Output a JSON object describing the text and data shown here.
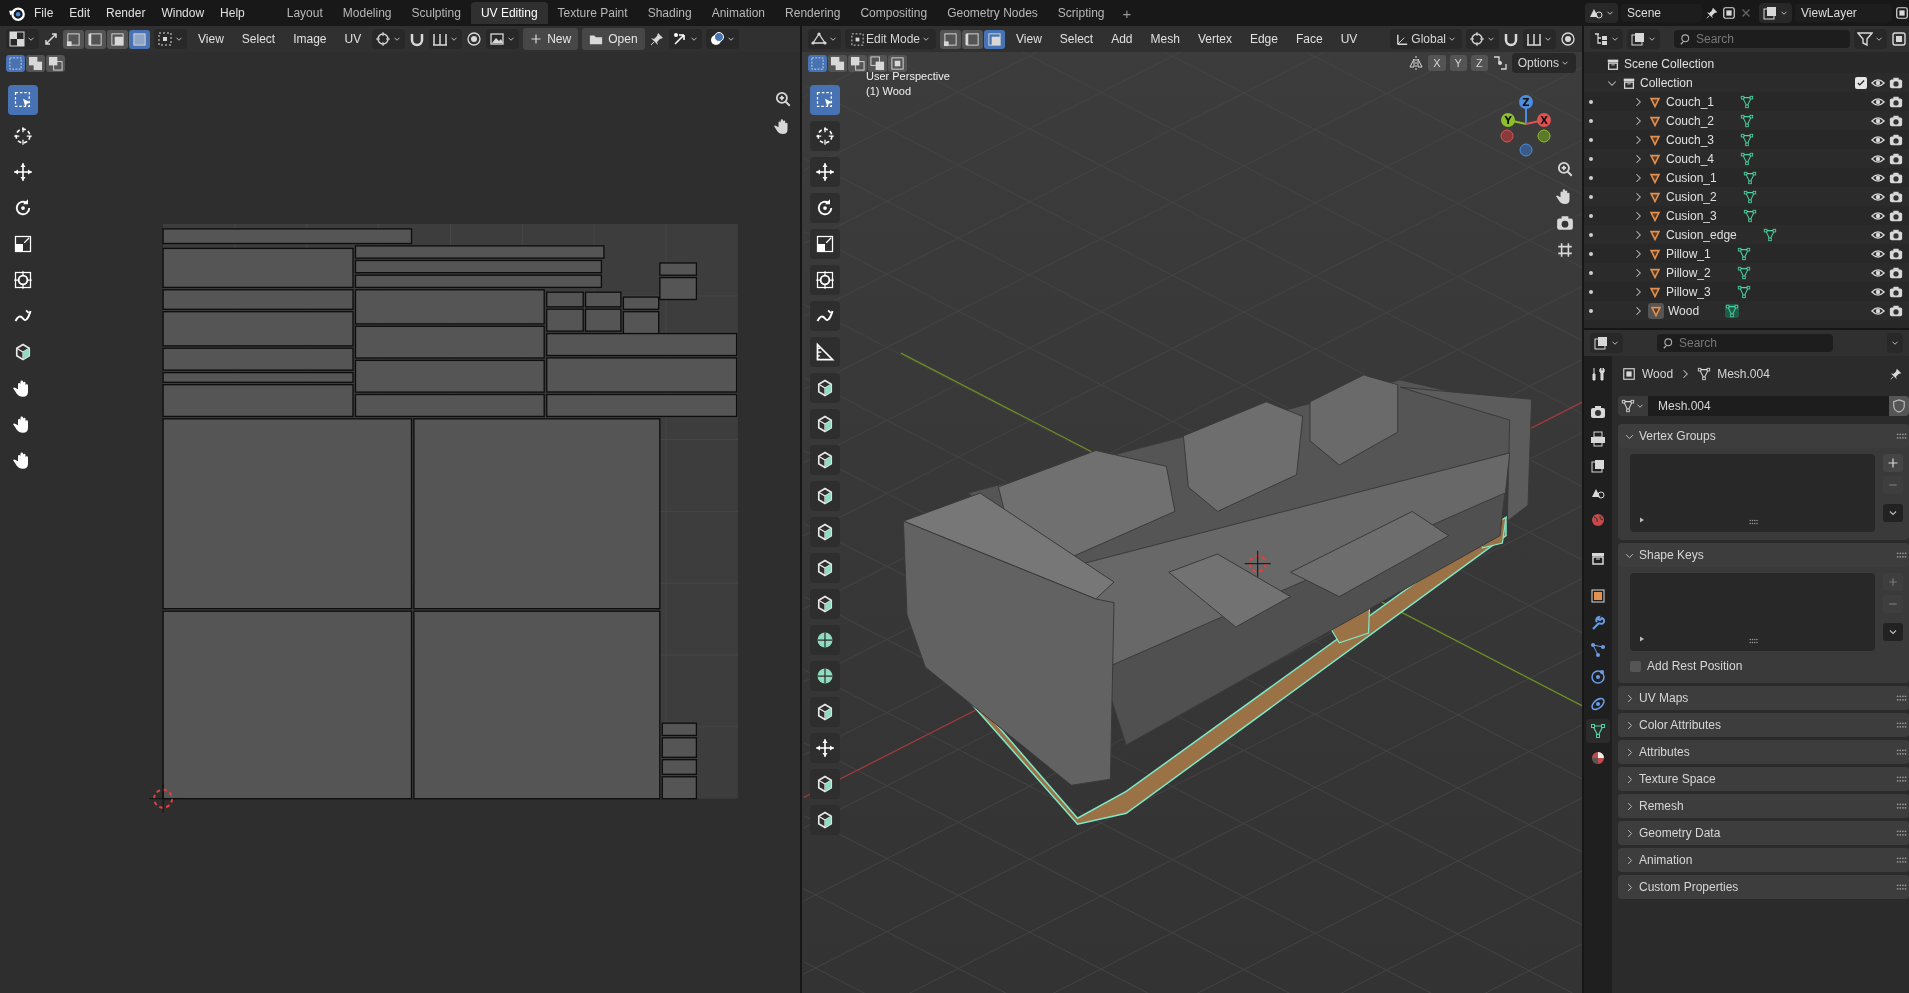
{
  "topbar": {
    "menus": [
      "File",
      "Edit",
      "Render",
      "Window",
      "Help"
    ],
    "workspaces": [
      {
        "label": "Layout",
        "selected": false
      },
      {
        "label": "Modeling",
        "selected": false
      },
      {
        "label": "Sculpting",
        "selected": false
      },
      {
        "label": "UV Editing",
        "selected": true
      },
      {
        "label": "Texture Paint",
        "selected": false
      },
      {
        "label": "Shading",
        "selected": false
      },
      {
        "label": "Animation",
        "selected": false
      },
      {
        "label": "Rendering",
        "selected": false
      },
      {
        "label": "Compositing",
        "selected": false
      },
      {
        "label": "Geometry Nodes",
        "selected": false
      },
      {
        "label": "Scripting",
        "selected": false
      }
    ],
    "add_workspace": "+",
    "scene": "Scene",
    "view_layer": "ViewLayer"
  },
  "uv_editor": {
    "select_modes": [
      {
        "kind": "vertex",
        "selected": false
      },
      {
        "kind": "edge",
        "selected": false
      },
      {
        "kind": "face",
        "selected": false
      },
      {
        "kind": "island",
        "selected": true
      }
    ],
    "menus": [
      "View",
      "Select",
      "Image",
      "UV"
    ],
    "new_button": "New",
    "open_button": "Open",
    "box_modes": [
      {
        "selected": true
      },
      {
        "selected": false
      },
      {
        "selected": false
      }
    ],
    "tools": [
      {
        "kind": "select",
        "selected": true
      },
      {
        "kind": "cursor",
        "selected": false
      },
      {
        "kind": "move",
        "selected": false
      },
      {
        "kind": "rotate",
        "selected": false
      },
      {
        "kind": "scale",
        "selected": false
      },
      {
        "kind": "transform",
        "selected": false
      },
      {
        "kind": "annotate",
        "selected": false
      },
      {
        "kind": "cube",
        "selected": false
      },
      {
        "kind": "hand",
        "selected": false
      },
      {
        "kind": "hand",
        "selected": false
      },
      {
        "kind": "hand",
        "selected": false
      }
    ]
  },
  "viewport": {
    "mode": "Edit Mode",
    "select_modes": [
      {
        "kind": "vertex",
        "selected": false
      },
      {
        "kind": "edge",
        "selected": false
      },
      {
        "kind": "face",
        "selected": true
      }
    ],
    "menus": [
      "View",
      "Select",
      "Add",
      "Mesh",
      "Vertex",
      "Edge",
      "Face",
      "UV"
    ],
    "orientation": "Global",
    "box_modes": [
      {
        "selected": true
      },
      {
        "selected": false
      },
      {
        "selected": false
      },
      {
        "selected": false
      },
      {
        "selected": false
      }
    ],
    "axes": [
      "X",
      "Y",
      "Z"
    ],
    "options": "Options",
    "view_name": "User Perspective",
    "object_label": "(1) Wood",
    "gizmo_labels": [
      "Y",
      "Z",
      "X"
    ],
    "tools": [
      {
        "kind": "select",
        "selected": true
      },
      {
        "kind": "cursor",
        "selected": false
      },
      {
        "kind": "move",
        "selected": false
      },
      {
        "kind": "rotate",
        "selected": false
      },
      {
        "kind": "scale",
        "selected": false
      },
      {
        "kind": "transform",
        "selected": false
      },
      {
        "kind": "annotate",
        "selected": false
      },
      {
        "kind": "measure",
        "selected": false
      },
      {
        "kind": "cube",
        "selected": false
      },
      {
        "kind": "cube",
        "selected": false
      },
      {
        "kind": "cube",
        "selected": false
      },
      {
        "kind": "cube",
        "selected": false
      },
      {
        "kind": "cube",
        "selected": false
      },
      {
        "kind": "cube",
        "selected": false
      },
      {
        "kind": "cube",
        "selected": false
      },
      {
        "kind": "sphere",
        "selected": false
      },
      {
        "kind": "sphere",
        "selected": false
      },
      {
        "kind": "cube",
        "selected": false
      },
      {
        "kind": "move",
        "selected": false
      },
      {
        "kind": "cube",
        "selected": false
      },
      {
        "kind": "cube",
        "selected": false
      }
    ]
  },
  "outliner": {
    "search": {
      "placeholder": "Search"
    },
    "scene_collection": "Scene Collection",
    "collection": {
      "label": "Collection",
      "expanded": true,
      "checked": true
    },
    "objects": [
      {
        "label": "Couch_1",
        "selected": false
      },
      {
        "label": "Couch_2",
        "selected": false
      },
      {
        "label": "Couch_3",
        "selected": false
      },
      {
        "label": "Couch_4",
        "selected": false
      },
      {
        "label": "Cusion_1",
        "selected": false
      },
      {
        "label": "Cusion_2",
        "selected": false
      },
      {
        "label": "Cusion_3",
        "selected": false
      },
      {
        "label": "Cusion_edge",
        "selected": false
      },
      {
        "label": "Pillow_1",
        "selected": false
      },
      {
        "label": "Pillow_2",
        "selected": false
      },
      {
        "label": "Pillow_3",
        "selected": false
      },
      {
        "label": "Wood",
        "selected": true
      }
    ]
  },
  "properties": {
    "search": {
      "placeholder": "Search"
    },
    "tabs": [
      {
        "kind": "tool",
        "selected": false
      },
      {
        "kind": "render",
        "selected": false
      },
      {
        "kind": "output",
        "selected": false
      },
      {
        "kind": "view_layer",
        "selected": false
      },
      {
        "kind": "scene",
        "selected": false
      },
      {
        "kind": "world",
        "selected": false
      },
      {
        "kind": "collection",
        "selected": false
      },
      {
        "kind": "object",
        "selected": false
      },
      {
        "kind": "modifiers",
        "selected": false
      },
      {
        "kind": "particles",
        "selected": false
      },
      {
        "kind": "physics",
        "selected": false
      },
      {
        "kind": "constraints",
        "selected": false
      },
      {
        "kind": "data",
        "selected": true
      },
      {
        "kind": "material",
        "selected": false
      }
    ],
    "breadcrumb": [
      "Wood",
      "Mesh.004"
    ],
    "mesh_name": "Mesh.004",
    "panels": [
      {
        "label": "Vertex Groups",
        "expanded": true
      },
      {
        "label": "Shape Keys",
        "expanded": true,
        "option": {
          "label": "Add Rest Position",
          "checked": false
        }
      },
      {
        "label": "UV Maps",
        "expanded": false
      },
      {
        "label": "Color Attributes",
        "expanded": false
      },
      {
        "label": "Attributes",
        "expanded": false
      },
      {
        "label": "Texture Space",
        "expanded": false
      },
      {
        "label": "Remesh",
        "expanded": false
      },
      {
        "label": "Geometry Data",
        "expanded": false
      },
      {
        "label": "Animation",
        "expanded": false
      },
      {
        "label": "Custom Properties",
        "expanded": false
      }
    ]
  }
}
